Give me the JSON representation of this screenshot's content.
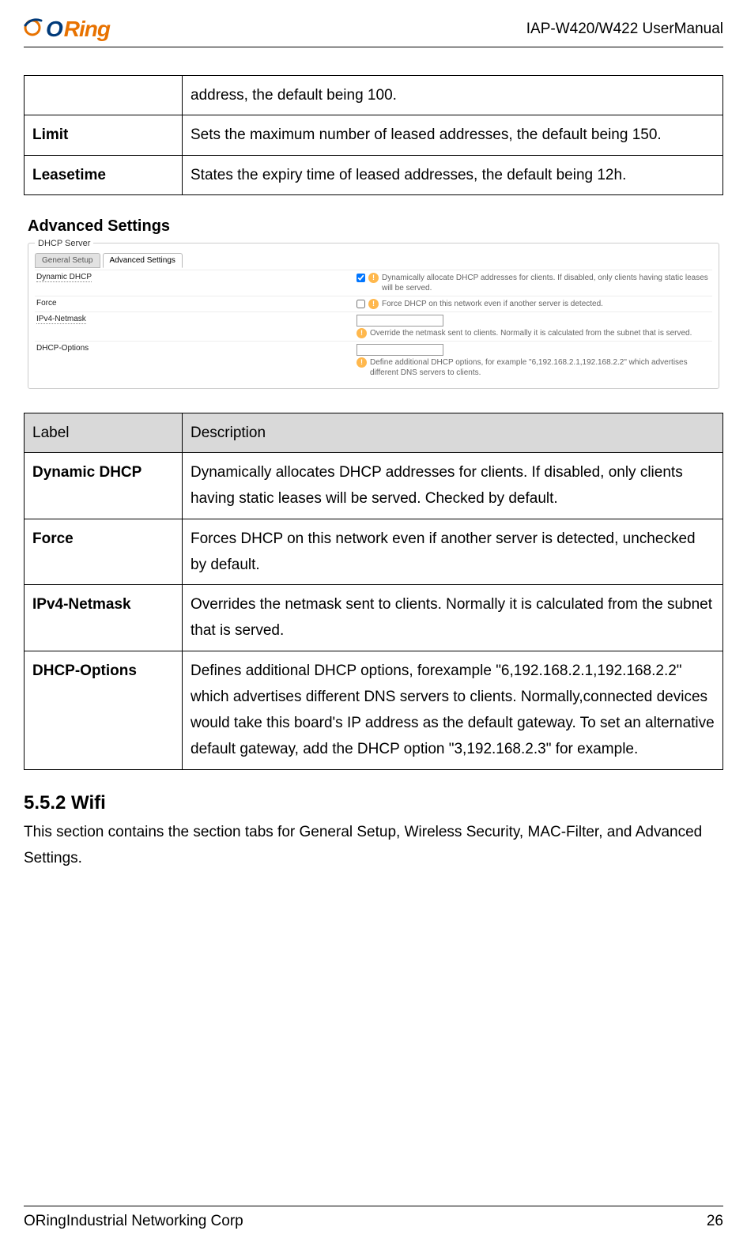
{
  "header": {
    "logo_o": "O",
    "logo_ring": "Ring",
    "doc_title": "IAP-W420/W422  UserManual"
  },
  "table1": {
    "rows": [
      {
        "label": "",
        "desc": "address, the default being 100."
      },
      {
        "label": "Limit",
        "desc": "Sets the maximum number of leased addresses, the default being 150."
      },
      {
        "label": "Leasetime",
        "desc": "States the expiry time of leased addresses, the default being 12h."
      }
    ]
  },
  "advanced": {
    "title": "Advanced Settings",
    "legend": "DHCP Server",
    "tabs": [
      {
        "label": "General Setup",
        "active": false
      },
      {
        "label": "Advanced Settings",
        "active": true
      }
    ],
    "rows": [
      {
        "label": "Dynamic DHCP",
        "dotted": true,
        "checkbox": true,
        "checked": true,
        "hint": "Dynamically allocate DHCP addresses for clients. If disabled, only clients having static leases will be served."
      },
      {
        "label": "Force",
        "dotted": false,
        "checkbox": true,
        "checked": false,
        "hint": "Force DHCP on this network even if another server is detected."
      },
      {
        "label": "IPv4-Netmask",
        "dotted": true,
        "textinput": true,
        "hint": "Override the netmask sent to clients. Normally it is calculated from the subnet that is served."
      },
      {
        "label": "DHCP-Options",
        "dotted": false,
        "textinput": true,
        "hint": "Define additional DHCP options, for example \"6,192.168.2.1,192.168.2.2\" which advertises different DNS servers to clients."
      }
    ]
  },
  "table2": {
    "header": {
      "label": "Label",
      "desc": "Description"
    },
    "rows": [
      {
        "label": "Dynamic DHCP",
        "desc": "Dynamically allocates DHCP addresses for clients. If disabled, only clients having static leases will be served. Checked by default."
      },
      {
        "label": "Force",
        "desc": "Forces DHCP on this network even if another server is detected, unchecked by default."
      },
      {
        "label": "IPv4-Netmask",
        "desc": "Overrides the netmask sent to clients. Normally it is calculated from the subnet that is served."
      },
      {
        "label": "DHCP-Options",
        "desc": "Defines additional DHCP options, forexample \"6,192.168.2.1,192.168.2.2\" which advertises different DNS servers to clients. Normally,connected devices would take this board's IP address as the default gateway. To set an alternative default gateway, add the DHCP option \"3,192.168.2.3\" for example."
      }
    ]
  },
  "wifi": {
    "heading": "5.5.2 Wifi",
    "para1": "This section contains the section tabs for General Setup, Wireless Security, MAC-Filter, and Advanced",
    "para2": "Settings."
  },
  "footer": {
    "left": "ORingIndustrial Networking Corp",
    "right": "26"
  }
}
